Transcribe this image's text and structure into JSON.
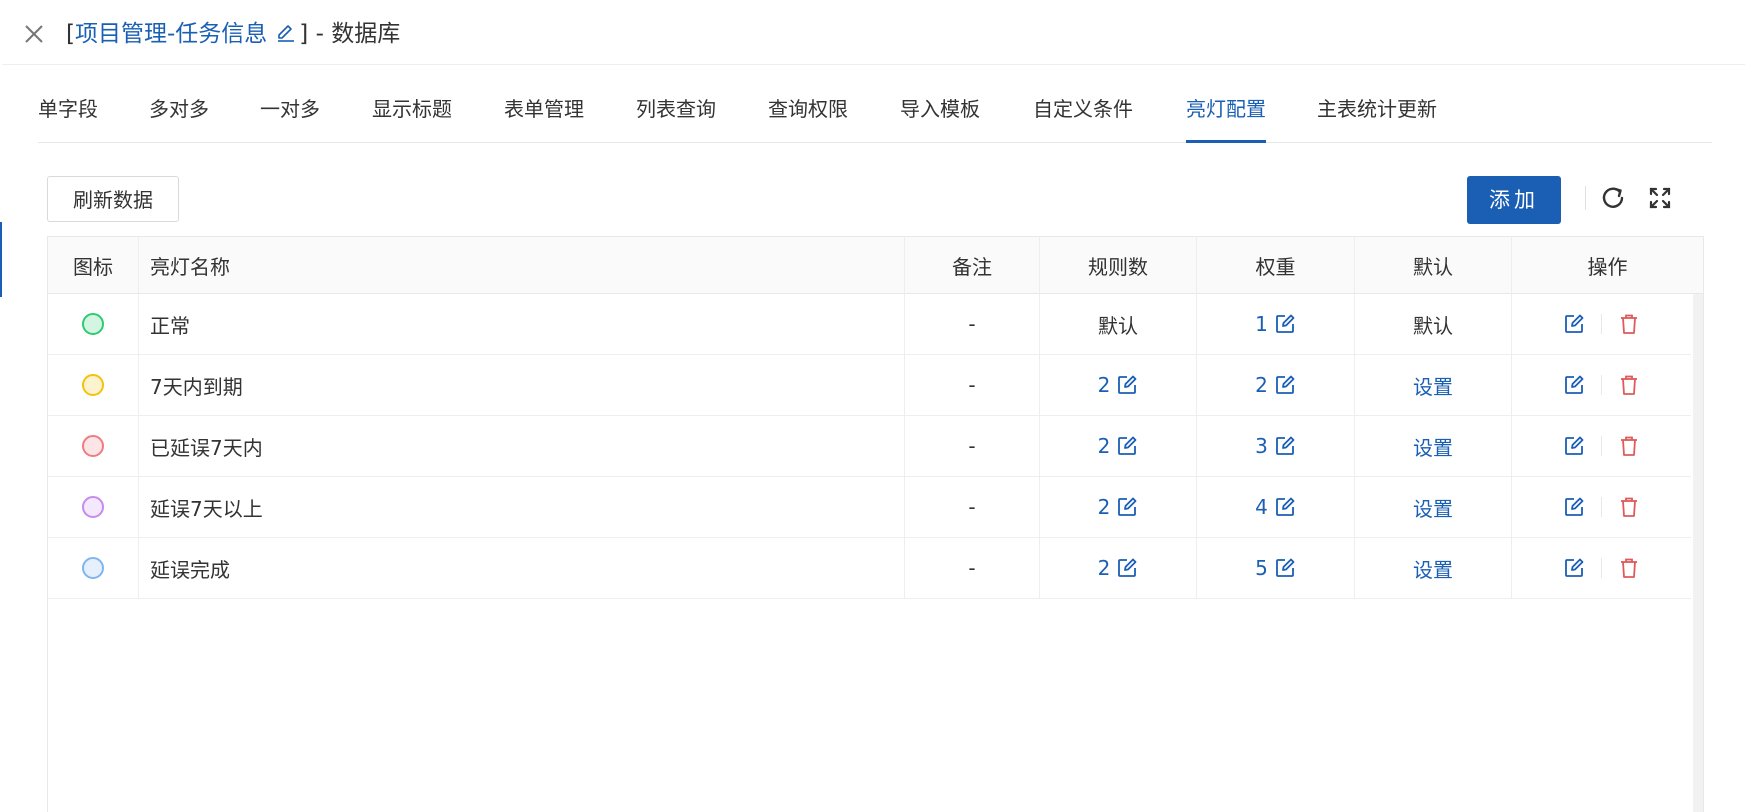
{
  "header": {
    "bracket_open": "[",
    "module": "项目管理-任务信息",
    "bracket_close": "]",
    "suffix": " - 数据库"
  },
  "tabs": [
    {
      "label": "单字段",
      "active": false
    },
    {
      "label": "多对多",
      "active": false
    },
    {
      "label": "一对多",
      "active": false
    },
    {
      "label": "显示标题",
      "active": false
    },
    {
      "label": "表单管理",
      "active": false
    },
    {
      "label": "列表查询",
      "active": false
    },
    {
      "label": "查询权限",
      "active": false
    },
    {
      "label": "导入模板",
      "active": false
    },
    {
      "label": "自定义条件",
      "active": false
    },
    {
      "label": "亮灯配置",
      "active": true
    },
    {
      "label": "主表统计更新",
      "active": false
    }
  ],
  "toolbar": {
    "refresh_label": "刷新数据",
    "add_label": "添加"
  },
  "table": {
    "columns": [
      "图标",
      "亮灯名称",
      "备注",
      "规则数",
      "权重",
      "默认",
      "操作"
    ],
    "rows": [
      {
        "dot_color": "#2ecc71",
        "name": "正常",
        "remark": "-",
        "rules": "默认",
        "rules_editable": false,
        "weight": "1",
        "default": "默认",
        "default_is_link": false
      },
      {
        "dot_color": "#f4c20d",
        "name": "7天内到期",
        "remark": "-",
        "rules": "2",
        "rules_editable": true,
        "weight": "2",
        "default": "设置",
        "default_is_link": true
      },
      {
        "dot_color": "#f07c82",
        "name": "已延误7天内",
        "remark": "-",
        "rules": "2",
        "rules_editable": true,
        "weight": "3",
        "default": "设置",
        "default_is_link": true
      },
      {
        "dot_color": "#c78bf0",
        "name": "延误7天以上",
        "remark": "-",
        "rules": "2",
        "rules_editable": true,
        "weight": "4",
        "default": "设置",
        "default_is_link": true
      },
      {
        "dot_color": "#7fb6ef",
        "name": "延误完成",
        "remark": "-",
        "rules": "2",
        "rules_editable": true,
        "weight": "5",
        "default": "设置",
        "default_is_link": true
      }
    ]
  },
  "colors": {
    "accent": "#1a5fb4",
    "danger": "#e05a5a"
  },
  "icons": {
    "close": "close-icon",
    "title_edit": "pencil-icon",
    "refresh": "refresh-icon",
    "fullscreen": "fullscreen-icon",
    "row_edit": "edit-icon",
    "row_delete": "trash-icon"
  }
}
